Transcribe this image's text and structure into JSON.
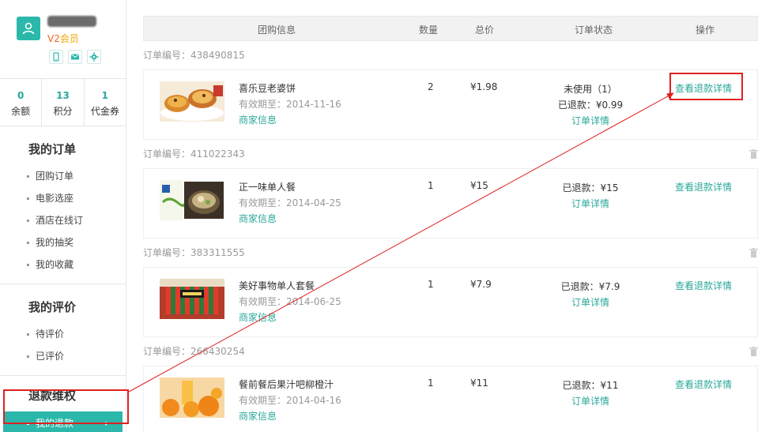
{
  "sidebar": {
    "level_prefix": "V2",
    "level_suffix": "会员",
    "stats": [
      {
        "num": "0",
        "label": "余额"
      },
      {
        "num": "13",
        "label": "积分"
      },
      {
        "num": "1",
        "label": "代金券"
      }
    ],
    "sections": [
      {
        "title": "我的订单",
        "items": [
          "团购订单",
          "电影选座",
          "酒店在线订",
          "我的抽奖",
          "我的收藏"
        ]
      },
      {
        "title": "我的评价",
        "items": [
          "待评价",
          "已评价"
        ]
      },
      {
        "title": "退款维权",
        "items": [
          "我的退款"
        ]
      }
    ],
    "active_arrow": "›"
  },
  "table": {
    "headers": {
      "info": "团购信息",
      "qty": "数量",
      "total": "总价",
      "status": "订单状态",
      "ops": "操作"
    }
  },
  "orders": [
    {
      "order_no": "订单编号：438490815",
      "name": "喜乐豆老婆饼",
      "expiry": "有效期至：2014-11-16",
      "merchant": "商家信息",
      "qty": "2",
      "price": "¥1.98",
      "status_lines": [
        "未使用（1）",
        "已退款：¥0.99"
      ],
      "detail": "订单详情",
      "refund": "查看退款详情"
    },
    {
      "order_no": "订单编号：411022343",
      "name": "正一味单人餐",
      "expiry": "有效期至：2014-04-25",
      "merchant": "商家信息",
      "qty": "1",
      "price": "¥15",
      "status_lines": [
        "已退款：¥15"
      ],
      "detail": "订单详情",
      "refund": "查看退款详情"
    },
    {
      "order_no": "订单编号：383311555",
      "name": "美好事物单人套餐",
      "expiry": "有效期至：2014-06-25",
      "merchant": "商家信息",
      "qty": "1",
      "price": "¥7.9",
      "status_lines": [
        "已退款：¥7.9"
      ],
      "detail": "订单详情",
      "refund": "查看退款详情"
    },
    {
      "order_no": "订单编号：266430254",
      "name": "餐前餐后果汁吧柳橙汁",
      "expiry": "有效期至：2014-04-16",
      "merchant": "商家信息",
      "qty": "1",
      "price": "¥11",
      "status_lines": [
        "已退款：¥11"
      ],
      "detail": "订单详情",
      "refund": "查看退款详情"
    }
  ],
  "colors": {
    "accent": "#2bb8aa",
    "link": "#2aa89a",
    "annotation": "#e02020"
  }
}
